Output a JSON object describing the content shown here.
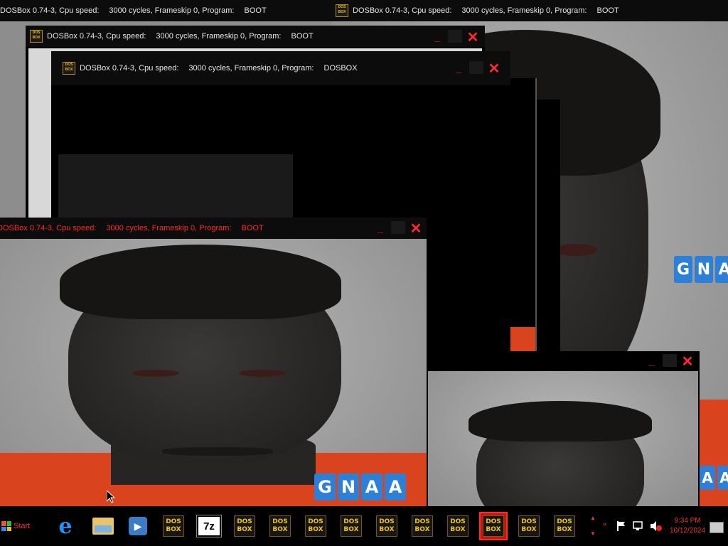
{
  "windows": [
    {
      "title": "DOSBox 0.74-3, Cpu speed:",
      "cycles": "3000 cycles, Frameskip  0, Program:",
      "program": "BOOT"
    },
    {
      "title": "DOSBox 0.74-3, Cpu speed:",
      "cycles": "3000 cycles, Frameskip  0, Program:",
      "program": "BOOT"
    },
    {
      "title": "DOSBox 0.74-3, Cpu speed:",
      "cycles": "3000 cycles, Frameskip  0, Program:",
      "program": "BOOT"
    },
    {
      "title": "DOSBox 0.74-3, Cpu speed:",
      "cycles": "3000 cycles, Frameskip  0, Program:",
      "program": "DOSBOX"
    },
    {
      "title": "DOSBox 0.74-3, Cpu speed:",
      "cycles": "3000 cycles, Frameskip  0, Program:",
      "program": "BOOT"
    }
  ],
  "watermark": [
    "G",
    "N",
    "A",
    "A"
  ],
  "dosbox_icon": {
    "line1": "DOS",
    "line2": "BOX"
  },
  "icons": {
    "ie": "e",
    "sevenzip": "7z",
    "media": "▶"
  },
  "taskbar": {
    "start_label": "Start",
    "time": "9:34 PM",
    "date": "10/12/2024"
  },
  "colors": {
    "title_red": "#ff2a2a",
    "shirt_orange": "#d9431e",
    "watermark_blue": "#2e7fd6",
    "dosbox_gold": "#f2c21a"
  }
}
